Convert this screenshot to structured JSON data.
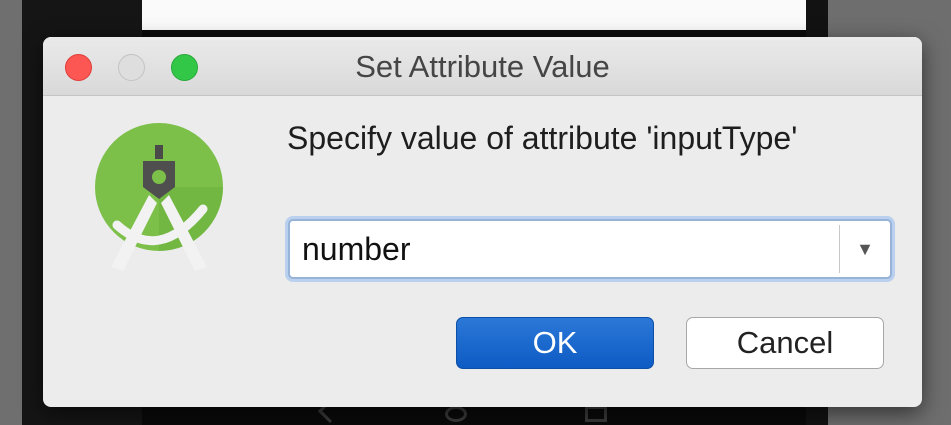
{
  "dialog": {
    "title": "Set Attribute Value",
    "prompt": "Specify value of attribute 'inputType'",
    "app_icon": "android-studio-icon"
  },
  "window_controls": {
    "close": "close-icon",
    "minimize": "minimize-icon",
    "zoom": "zoom-icon",
    "colors": {
      "close": "#fc5753",
      "minimize": "#dedede",
      "zoom": "#33c748"
    }
  },
  "combo": {
    "value": "number",
    "arrow_icon": "chevron-down-icon"
  },
  "buttons": {
    "ok_label": "OK",
    "cancel_label": "Cancel"
  },
  "colors": {
    "accent": "#0d5bc4",
    "focus_ring": "#b9d0ee",
    "icon_green": "#7cc04a"
  }
}
